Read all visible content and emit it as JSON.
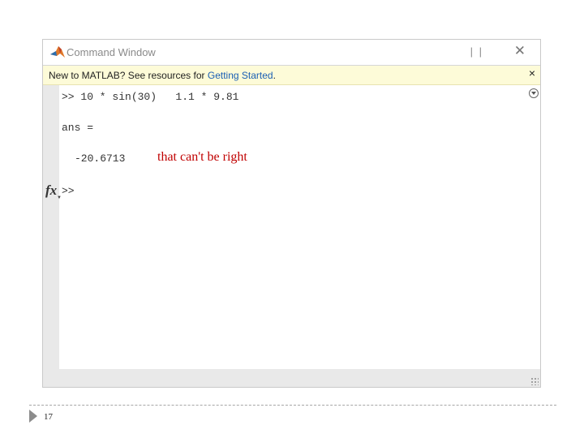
{
  "window": {
    "title": "Command Window",
    "controls_label": "| |",
    "close_label": "✕"
  },
  "notice": {
    "text_before": "New to MATLAB? See resources for ",
    "link": "Getting Started",
    "text_after": ".",
    "close_label": "×"
  },
  "console": {
    "command_line": ">> 10 * sin(30)   1.1 * 9.81",
    "output_label": "ans =",
    "output_value": "-20.6713",
    "prompt": ">>",
    "fx_label": "fx",
    "fx_caret": "▼"
  },
  "annotation": "that can't be right",
  "slide": {
    "page_number": "17"
  },
  "colors": {
    "annotation": "#c00000",
    "notice_bg": "#fdfbd8",
    "link": "#1a5fb4"
  },
  "icons": [
    "matlab-logo-icon",
    "close-icon",
    "panel-menu-icon",
    "fx-icon",
    "resize-grip-icon",
    "slide-bullet-icon"
  ]
}
